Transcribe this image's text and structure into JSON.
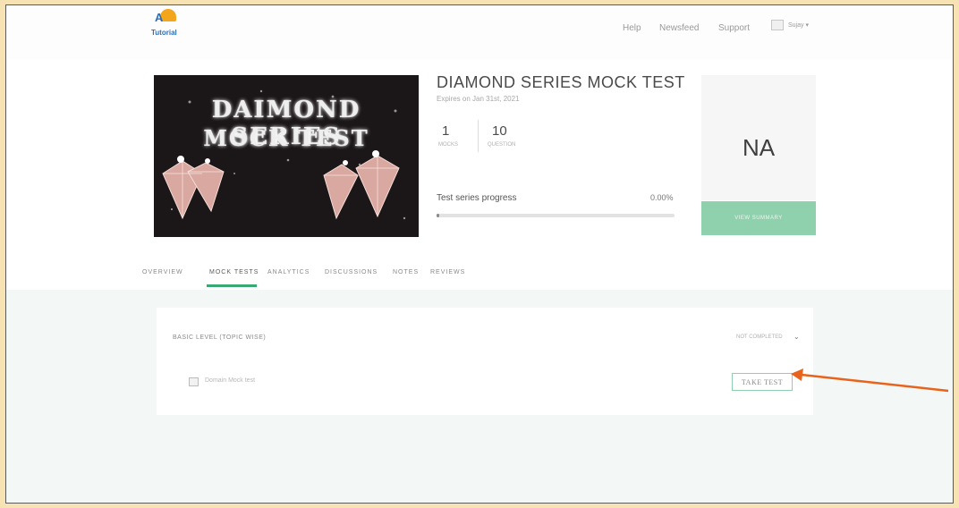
{
  "header": {
    "logo_text": "Tutorial",
    "nav": [
      "Help",
      "Newsfeed",
      "Support"
    ],
    "user_label": "Sujay"
  },
  "course": {
    "banner_line1": "DAIMOND SERIES",
    "banner_line2": "MOCK TEST",
    "title": "DIAMOND SERIES MOCK TEST",
    "expiry": "Expires on Jan 31st, 2021",
    "mocks_count": "1",
    "mocks_label": "MOCKS",
    "questions_count": "10",
    "questions_label": "QUESTION",
    "progress_label": "Test series progress",
    "progress_value": "0.00%",
    "progress_fraction": 0.0,
    "score": "NA",
    "cta_label": "VIEW SUMMARY"
  },
  "tabs": [
    "OVERVIEW",
    "MOCK TESTS",
    "ANALYTICS",
    "DISCUSSIONS",
    "NOTES",
    "REVIEWS"
  ],
  "active_tab": "MOCK TESTS",
  "section": {
    "title": "BASIC LEVEL (TOPIC WISE)",
    "filter_label": "NOT COMPLETED",
    "item_text": "Domain Mock test",
    "take_test_label": "TAKE TEST"
  },
  "colors": {
    "accent": "#3aa873",
    "cta_background": "#8fd1ad",
    "annotation_arrow": "#e8641c",
    "outer_background": "#f7e2b4"
  }
}
